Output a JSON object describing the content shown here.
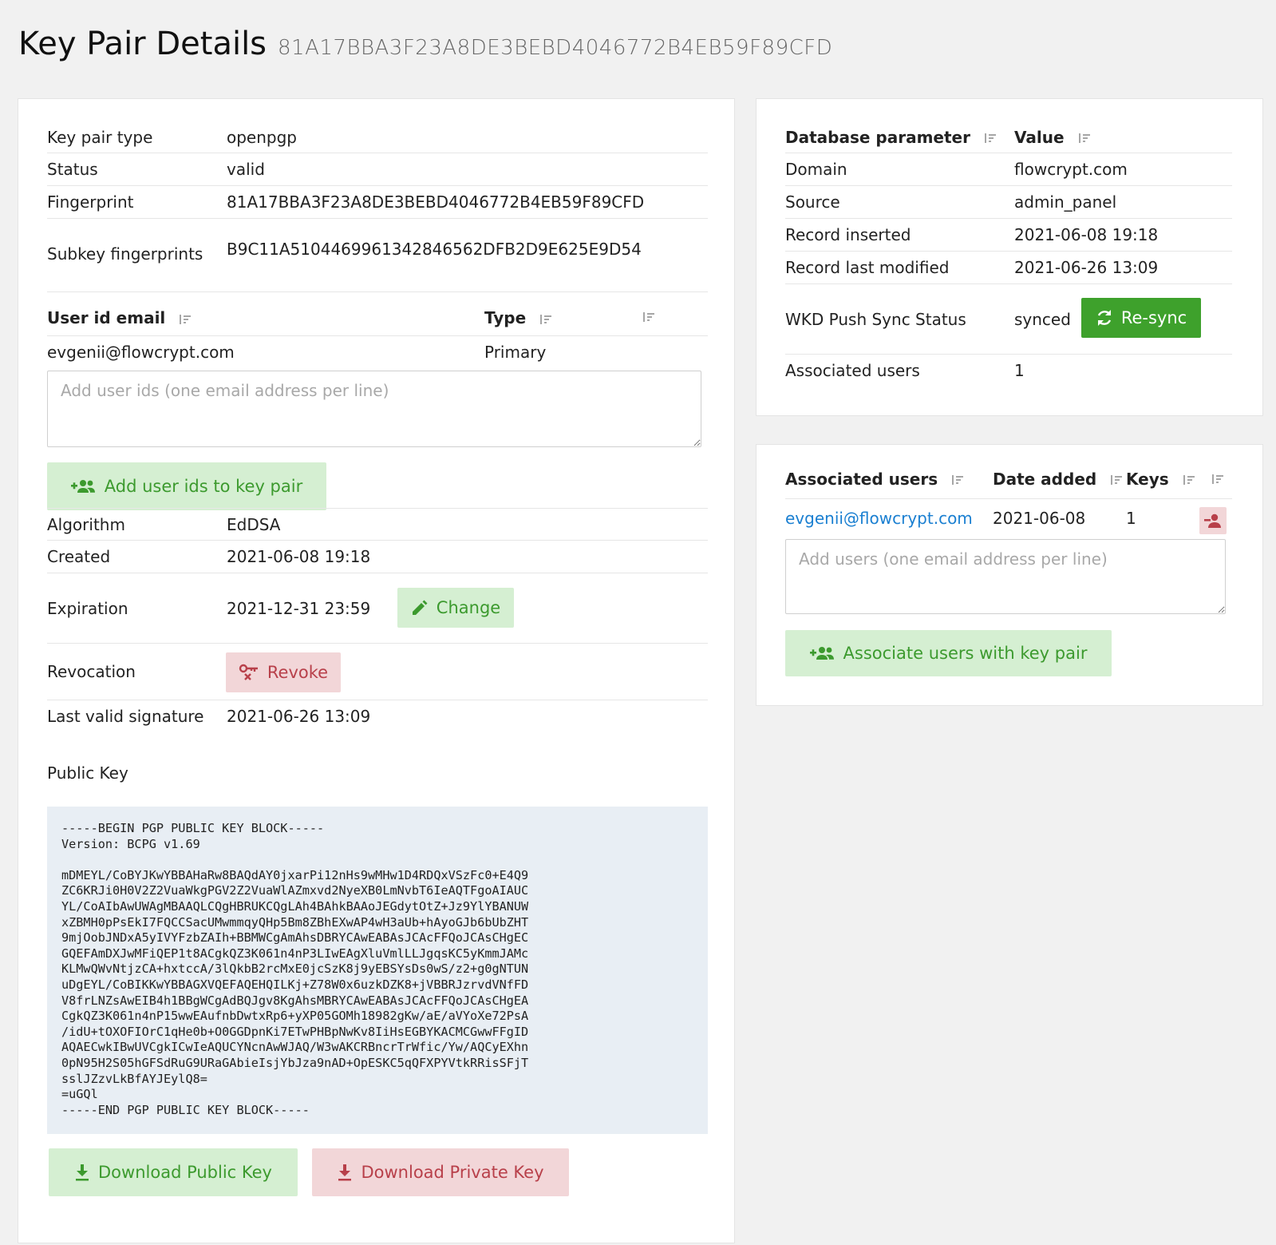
{
  "header": {
    "title": "Key Pair Details",
    "subtitle": "81A17BBA3F23A8DE3BEBD4046772B4EB59F89CFD"
  },
  "details": {
    "key_pair_type_label": "Key pair type",
    "key_pair_type_value": "openpgp",
    "status_label": "Status",
    "status_value": "valid",
    "fingerprint_label": "Fingerprint",
    "fingerprint_value": "81A17BBA3F23A8DE3BEBD4046772B4EB59F89CFD",
    "subkey_label": "Subkey fingerprints",
    "subkey_value": "B9C11A510446996134284656​2DFB2D9E625E9D54"
  },
  "user_ids": {
    "col_email": "User id email",
    "col_type": "Type",
    "rows": [
      {
        "email": "evgenii@flowcrypt.com",
        "type": "Primary"
      }
    ],
    "placeholder": "Add user ids (one email address per line)",
    "add_button": "Add user ids to key pair"
  },
  "key_info": {
    "algorithm_label": "Algorithm",
    "algorithm_value": "EdDSA",
    "created_label": "Created",
    "created_value": "2021-06-08 19:18",
    "expiration_label": "Expiration",
    "expiration_value": "2021-12-31 23:59",
    "change_button": "Change",
    "revocation_label": "Revocation",
    "revoke_button": "Revoke",
    "last_sig_label": "Last valid signature",
    "last_sig_value": "2021-06-26 13:09"
  },
  "public_key": {
    "heading": "Public Key",
    "text": "-----BEGIN PGP PUBLIC KEY BLOCK-----\nVersion: BCPG v1.69\n\nmDMEYL/CoBYJKwYBBAHaRw8BAQdAY0jxarPi12nHs9wMHw1D4RDQxVSzFc0+E4Q9\nZC6KRJi0H0V2Z2VuaWkgPGV2Z2VuaWlAZmxvd2NyeXB0LmNvbT6IeAQTFgoAIAUC\nYL/CoAIbAwUWAgMBAAQLCQgHBRUKCQgLAh4BAhkBAAoJEGdytOtZ+Jz9YlYBANUW\nxZBMH0pPsEkI7FQCCSacUMwmmqyQHp5Bm8ZBhEXwAP4wH3aUb+hAyoGJb6bUbZHT\n9mjOobJNDxA5yIVYFzbZAIh+BBMWCgAmAhsDBRYCAwEABAsJCAcFFQoJCAsCHgEC\nGQEFAmDXJwMFiQEP1t8ACgkQZ3K061n4nP3LIwEAgXluVmlLLJgqsKC5yKmmJAMc\nKLMwQWvNtjzCA+hxtccA/3lQkbB2rcMxE0jcSzK8j9yEBSYsDs0wS/z2+g0gNTUN\nuDgEYL/CoBIKKwYBBAGXVQEFAQEHQILKj+Z78W0x6uzkDZK8+jVBBRJzrvdVNfFD\nV8frLNZsAwEIB4h1BBgWCgAdBQJgv8KgAhsMBRYCAwEABAsJCAcFFQoJCAsCHgEA\nCgkQZ3K061n4nP15wwEAufnbDwtxRp6+yXP05GOMh18982gKw/aE/aVYoXe72PsA\n/idU+tOXOFIOrC1qHe0b+O0GGDpnKi7ETwPHBpNwKv8IiHsEGBYKACMCGwwFFgID\nAQAECwkIBwUVCgkICwIeAQUCYNcnAwWJAQ/W3wAKCRBncrTrWfic/Yw/AQCyEXhn\n0pN95H2S05hGFSdRuG9URaGAbieIsjYbJza9nAD+OpESKC5qQFXPYVtkRRisSFjT\nsslJZzvLkBfAYJEylQ8=\n=uGQl\n-----END PGP PUBLIC KEY BLOCK-----"
  },
  "downloads": {
    "public_button": "Download Public Key",
    "private_button": "Download Private Key"
  },
  "db_params": {
    "col_param": "Database parameter",
    "col_value": "Value",
    "domain_label": "Domain",
    "domain_value": "flowcrypt.com",
    "source_label": "Source",
    "source_value": "admin_panel",
    "inserted_label": "Record inserted",
    "inserted_value": "2021-06-08 19:18",
    "modified_label": "Record last modified",
    "modified_value": "2021-06-26 13:09",
    "wkd_label": "WKD Push Sync Status",
    "wkd_value": "synced",
    "resync_button": "Re-sync",
    "assoc_label": "Associated users",
    "assoc_value": "1"
  },
  "associated": {
    "col_users": "Associated users",
    "col_date": "Date added",
    "col_keys": "Keys",
    "rows": [
      {
        "email": "evgenii@flowcrypt.com",
        "date": "2021-06-08",
        "keys": "1"
      }
    ],
    "placeholder": "Add users (one email address per line)",
    "associate_button": "Associate users with key pair"
  },
  "colors": {
    "accent_green": "#3ea12c",
    "soft_green": "#d5efd2",
    "soft_red": "#f2d6d8",
    "link_blue": "#1a7fd1"
  }
}
